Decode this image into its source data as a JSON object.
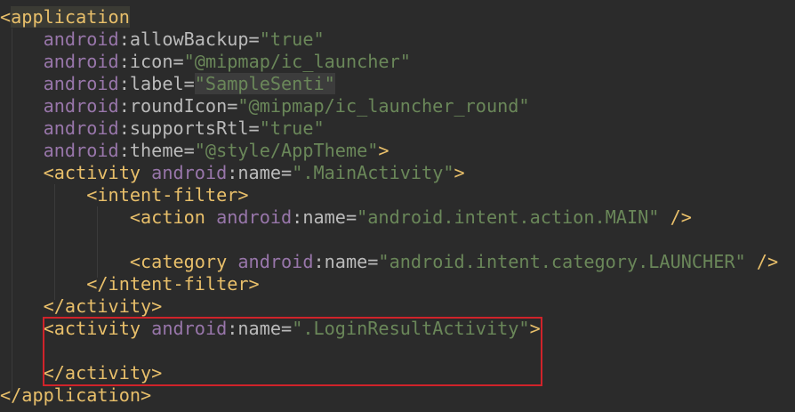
{
  "lines": [
    {
      "i": "",
      "p": [
        {
          "c": "brk",
          "t": "<"
        },
        {
          "c": "brk hl",
          "t": "application"
        }
      ]
    },
    {
      "i": "    ",
      "p": [
        {
          "c": "ns",
          "t": "android"
        },
        {
          "c": "attr",
          "t": ":allowBackup="
        },
        {
          "c": "val",
          "t": "\"true\""
        }
      ]
    },
    {
      "i": "    ",
      "p": [
        {
          "c": "ns",
          "t": "android"
        },
        {
          "c": "attr",
          "t": ":icon="
        },
        {
          "c": "val",
          "t": "\"@mipmap/ic_launcher\""
        }
      ]
    },
    {
      "i": "    ",
      "p": [
        {
          "c": "ns",
          "t": "android"
        },
        {
          "c": "attr",
          "t": ":label="
        },
        {
          "c": "val lbl",
          "t": "\"SampleSenti\""
        }
      ]
    },
    {
      "i": "    ",
      "p": [
        {
          "c": "ns",
          "t": "android"
        },
        {
          "c": "attr",
          "t": ":roundIcon="
        },
        {
          "c": "val",
          "t": "\"@mipmap/ic_launcher_round\""
        }
      ]
    },
    {
      "i": "    ",
      "p": [
        {
          "c": "ns",
          "t": "android"
        },
        {
          "c": "attr",
          "t": ":supportsRtl="
        },
        {
          "c": "val",
          "t": "\"true\""
        }
      ]
    },
    {
      "i": "    ",
      "p": [
        {
          "c": "ns",
          "t": "android"
        },
        {
          "c": "attr",
          "t": ":theme="
        },
        {
          "c": "val",
          "t": "\"@style/AppTheme\""
        },
        {
          "c": "brk",
          "t": ">"
        }
      ]
    },
    {
      "i": "    ",
      "p": [
        {
          "c": "brk",
          "t": "<activity "
        },
        {
          "c": "ns",
          "t": "android"
        },
        {
          "c": "attr",
          "t": ":name="
        },
        {
          "c": "val",
          "t": "\".MainActivity\""
        },
        {
          "c": "brk",
          "t": ">"
        }
      ]
    },
    {
      "i": "        ",
      "p": [
        {
          "c": "brk",
          "t": "<intent-filter>"
        }
      ]
    },
    {
      "i": "            ",
      "p": [
        {
          "c": "brk",
          "t": "<action "
        },
        {
          "c": "ns",
          "t": "android"
        },
        {
          "c": "attr",
          "t": ":name="
        },
        {
          "c": "val",
          "t": "\"android.intent.action.MAIN\""
        },
        {
          "c": "brk",
          "t": " />"
        }
      ]
    },
    {
      "i": "",
      "p": []
    },
    {
      "i": "            ",
      "p": [
        {
          "c": "brk",
          "t": "<category "
        },
        {
          "c": "ns",
          "t": "android"
        },
        {
          "c": "attr",
          "t": ":name="
        },
        {
          "c": "val",
          "t": "\"android.intent.category.LAUNCHER\""
        },
        {
          "c": "brk",
          "t": " />"
        }
      ]
    },
    {
      "i": "        ",
      "p": [
        {
          "c": "brk",
          "t": "</intent-filter>"
        }
      ]
    },
    {
      "i": "    ",
      "p": [
        {
          "c": "brk",
          "t": "</activity>"
        }
      ]
    },
    {
      "i": "    ",
      "p": [
        {
          "c": "brk",
          "t": "<activity "
        },
        {
          "c": "ns",
          "t": "android"
        },
        {
          "c": "attr",
          "t": ":name="
        },
        {
          "c": "val",
          "t": "\".LoginResultActivity\""
        },
        {
          "c": "brk",
          "t": ">"
        }
      ]
    },
    {
      "i": "",
      "p": []
    },
    {
      "i": "    ",
      "p": [
        {
          "c": "brk",
          "t": "</activity>"
        }
      ]
    },
    {
      "i": "",
      "p": [
        {
          "c": "brk",
          "t": "</application>"
        }
      ]
    }
  ],
  "highlight_color": "#d0232a"
}
